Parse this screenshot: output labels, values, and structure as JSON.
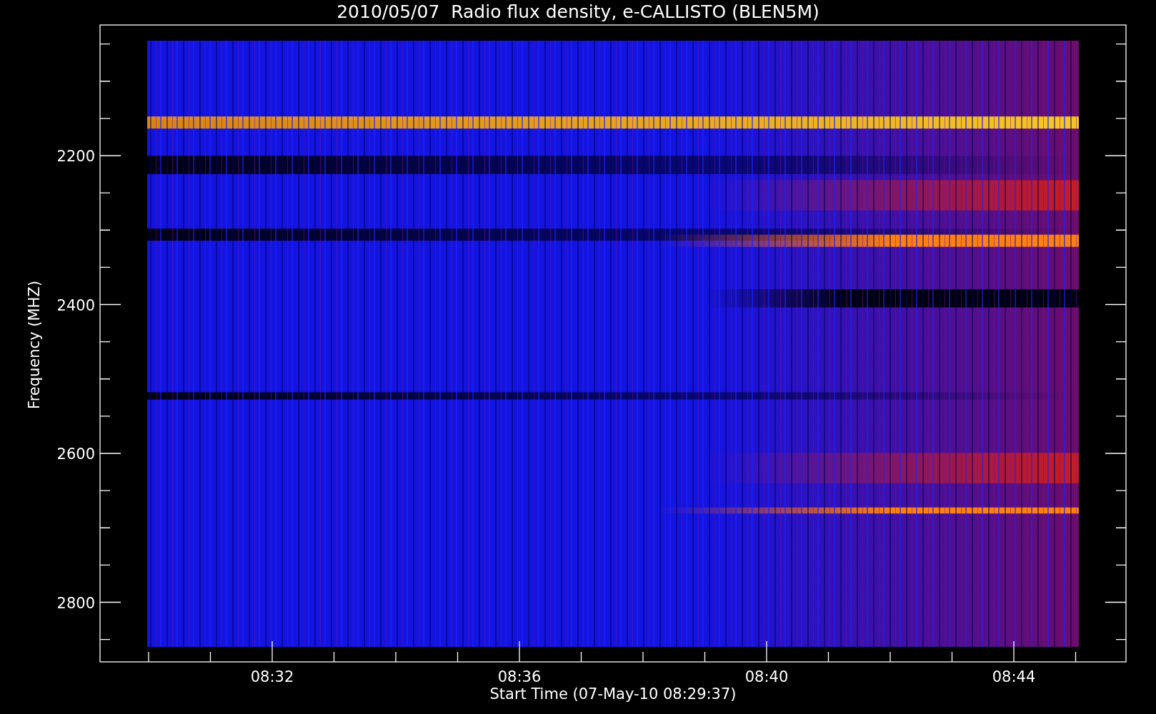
{
  "title": "2010/05/07  Radio flux density, e-CALLISTO (BLEN5M)",
  "y_axis": {
    "label": "Frequency (MHZ)",
    "ticks": [
      "2200",
      "2400",
      "2600",
      "2800"
    ]
  },
  "x_axis": {
    "label": "Start Time (07-May-10 08:29:37)",
    "ticks": [
      "08:32",
      "08:36",
      "08:40",
      "08:44"
    ]
  }
}
